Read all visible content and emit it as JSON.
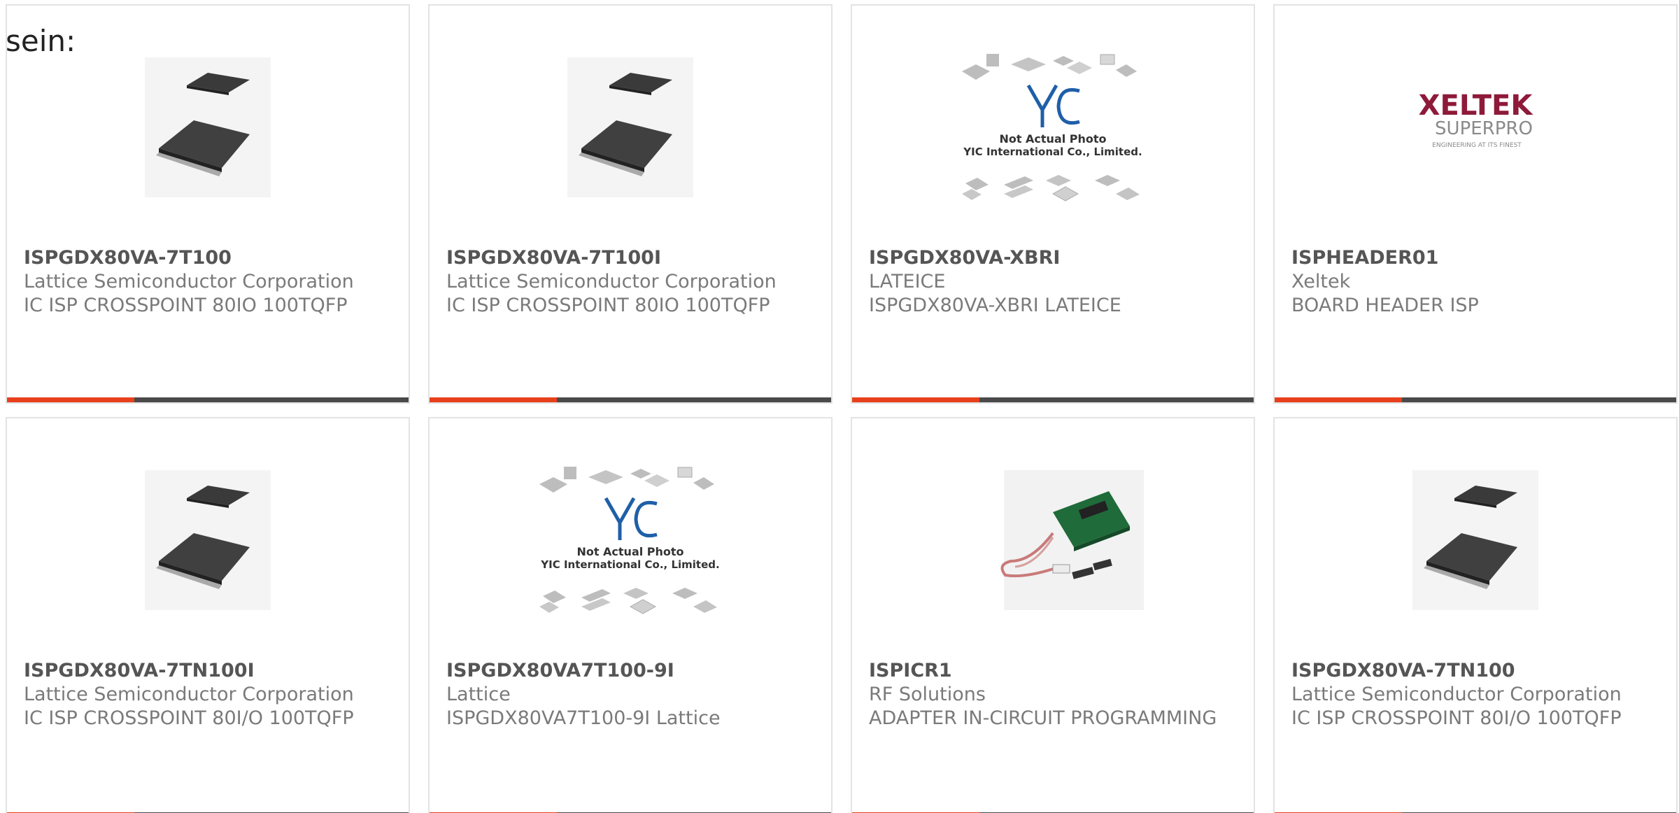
{
  "prefix": "sein:",
  "accent_color": "#e8401c",
  "bar_color": "#4a4a4a",
  "products": [
    {
      "part_number": "ISPGDX80VA-7T100",
      "manufacturer": "Lattice Semiconductor Corporation",
      "description": "IC ISP CROSSPOINT 80IO 100TQFP",
      "image": "tqfp-chip-icon"
    },
    {
      "part_number": "ISPGDX80VA-7T100I",
      "manufacturer": "Lattice Semiconductor Corporation",
      "description": "IC ISP CROSSPOINT 80IO 100TQFP",
      "image": "tqfp-chip-icon"
    },
    {
      "part_number": "ISPGDX80VA-XBRI",
      "manufacturer": "LATEICE",
      "description": "ISPGDX80VA-XBRI LATEICE",
      "image": "yic-placeholder-icon",
      "image_caption": [
        "Not Actual Photo",
        "YIC International Co., Limited."
      ]
    },
    {
      "part_number": "ISPHEADER01",
      "manufacturer": "Xeltek",
      "description": "BOARD HEADER ISP",
      "image": "xeltek-logo",
      "logo_text": [
        "XELTEK",
        "SUPERPRO",
        "ENGINEERING AT ITS FINEST"
      ]
    },
    {
      "part_number": "ISPGDX80VA-7TN100I",
      "manufacturer": "Lattice Semiconductor Corporation",
      "description": "IC ISP CROSSPOINT 80I/O 100TQFP",
      "image": "tqfp-chip-icon"
    },
    {
      "part_number": "ISPGDX80VA7T100-9I",
      "manufacturer": "Lattice",
      "description": "ISPGDX80VA7T100-9I Lattice",
      "image": "yic-placeholder-icon",
      "image_caption": [
        "Not Actual Photo",
        "YIC International Co., Limited."
      ]
    },
    {
      "part_number": "ISPICR1",
      "manufacturer": "RF Solutions",
      "description": "ADAPTER IN-CIRCUIT PROGRAMMING",
      "image": "adapter-board-icon"
    },
    {
      "part_number": "ISPGDX80VA-7TN100",
      "manufacturer": "Lattice Semiconductor Corporation",
      "description": "IC ISP CROSSPOINT 80I/O 100TQFP",
      "image": "tqfp-chip-icon"
    }
  ]
}
